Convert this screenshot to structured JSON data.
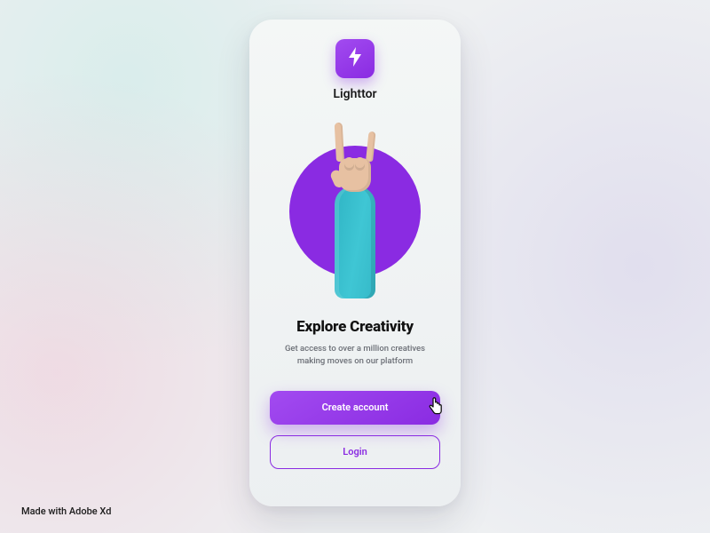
{
  "app": {
    "name": "Lighttor"
  },
  "hero": {
    "headline": "Explore Creativity",
    "subtext": "Get access to over a million creatives making moves on our platform"
  },
  "actions": {
    "primary_label": "Create account",
    "secondary_label": "Login"
  },
  "footer": {
    "attribution": "Made with Adobe Xd"
  },
  "colors": {
    "accent": "#8a2be2",
    "sleeve": "#35b9c8"
  }
}
